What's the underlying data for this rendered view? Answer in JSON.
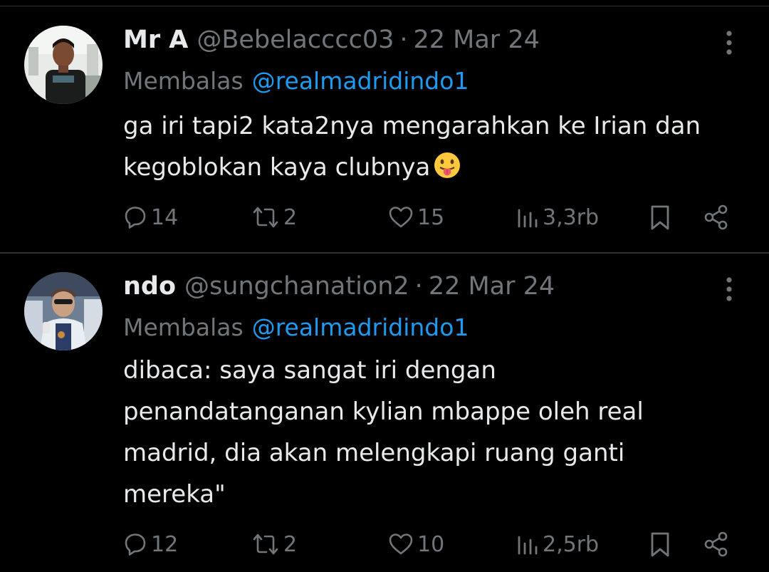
{
  "tweets": [
    {
      "name": "Mr A",
      "handle": "@Bebelacccc03",
      "separator": "·",
      "date": "22 Mar 24",
      "reply_prefix": "Membalas",
      "reply_to": "@realmadridindo1",
      "text_lines": [
        "ga iri tapi2 kata2nya mengarahkan ke Irian dan",
        "kegoblokan kaya clubnya"
      ],
      "emoji": "face-with-tongue-emoji",
      "replies": "14",
      "reposts": "2",
      "likes": "15",
      "views": "3,3rb"
    },
    {
      "name": "ndo",
      "handle": "@sungchanation2",
      "separator": "·",
      "date": "22 Mar 24",
      "reply_prefix": "Membalas",
      "reply_to": "@realmadridindo1",
      "text_lines": [
        "dibaca: saya sangat iri dengan",
        "penandatanganan kylian mbappe oleh real",
        "madrid, dia akan melengkapi ruang ganti",
        "mereka\""
      ],
      "replies": "12",
      "reposts": "2",
      "likes": "10",
      "views": "2,5rb"
    }
  ],
  "colors": {
    "background": "#000000",
    "text": "#e7e9ea",
    "secondary": "#71767b",
    "link": "#1d9bf0",
    "divider": "#2f3336"
  }
}
